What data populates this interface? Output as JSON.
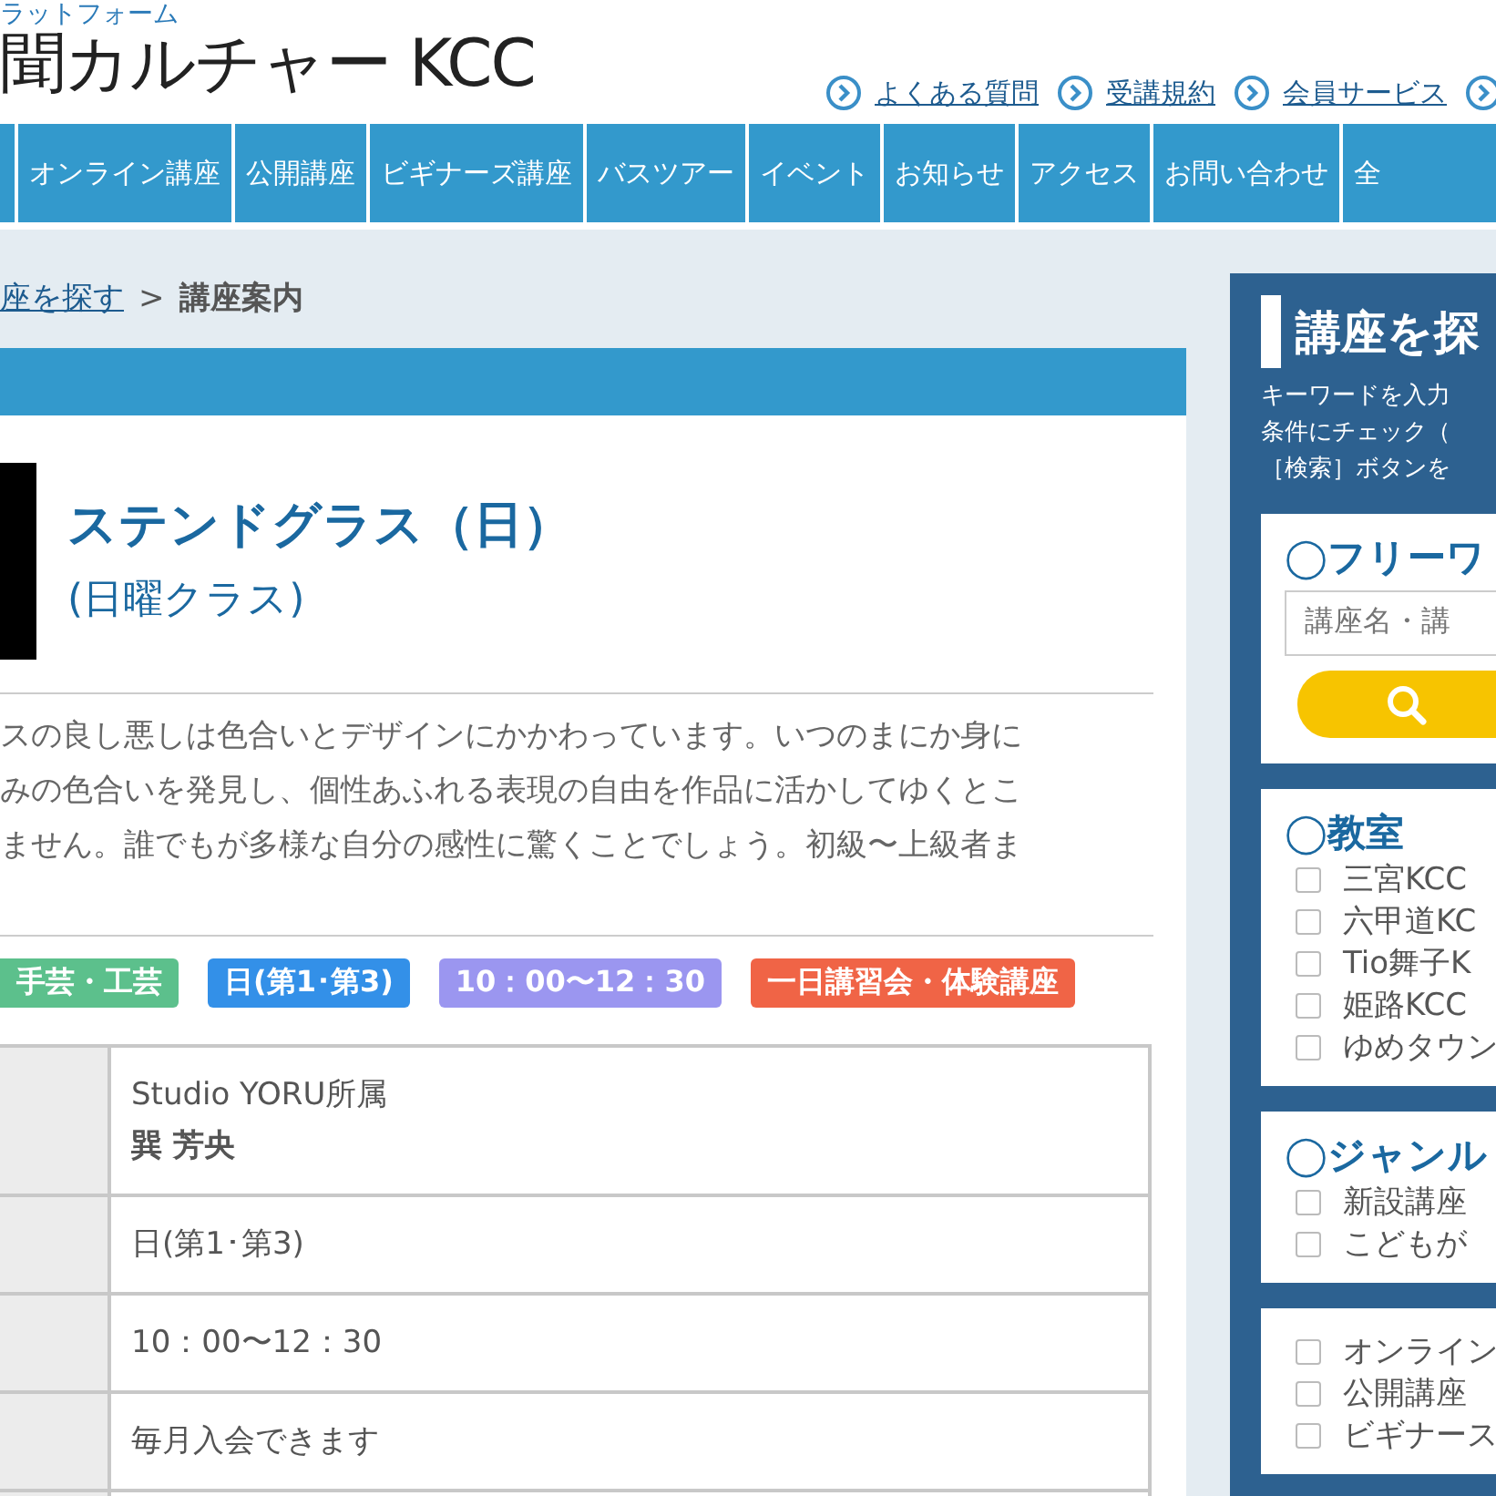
{
  "header": {
    "logo_sub": "ラットフォーム",
    "logo": "聞カルチャー KCC",
    "links": [
      "よくある質問",
      "受講規約",
      "会員サービス"
    ]
  },
  "nav": [
    "オンライン講座",
    "公開講座",
    "ビギナーズ講座",
    "バスツアー",
    "イベント",
    "お知らせ",
    "アクセス",
    "お問い合わせ",
    "全"
  ],
  "breadcrumb": {
    "link": "座を探す",
    "separator": ">",
    "current": "講座案内"
  },
  "course": {
    "title": "ステンドグラス（日）",
    "subtitle": "(日曜クラス)",
    "description": [
      "スの良し悪しは色合いとデザインにかかわっています。いつのまにか身に",
      "みの色合いを発見し、個性あふれる表現の自由を作品に活かしてゆくとこ",
      "ません。誰でもが多様な自分の感性に驚くことでしょう。初級〜上級者ま"
    ],
    "tags": [
      {
        "label": "手芸・工芸",
        "color": "#5cc08c"
      },
      {
        "label": "日(第1･第3)",
        "color": "#3390e8"
      },
      {
        "label": "10：00〜12：30",
        "color": "#9b96f0"
      },
      {
        "label": "一日講習会・体験講座",
        "color": "#f06446"
      }
    ],
    "details": [
      {
        "lines": [
          "Studio YORU所属",
          "巽 芳央"
        ]
      },
      {
        "lines": [
          "日(第1･第3)"
        ]
      },
      {
        "lines": [
          "10：00〜12：30"
        ]
      },
      {
        "lines": [
          "毎月入会できます"
        ]
      }
    ]
  },
  "sidebar": {
    "title": "講座を探",
    "intro": [
      "キーワードを入力",
      "条件にチェック（",
      "［検索］ボタンを"
    ],
    "freeword": {
      "heading": "◯フリーワ",
      "placeholder": "講座名・講"
    },
    "groups": [
      {
        "heading": "◯教室",
        "options": [
          {
            "label": "三宮KCC",
            "checked": false
          },
          {
            "label": "六甲道KC",
            "checked": false
          },
          {
            "label": "Tio舞子K",
            "checked": false
          },
          {
            "label": "姫路KCC",
            "checked": false
          },
          {
            "label": "ゆめタウン",
            "checked": false
          }
        ]
      },
      {
        "heading": "◯ジャンル",
        "options": [
          {
            "label": "新設講座",
            "checked": false
          },
          {
            "label": "こどもが",
            "checked": false
          }
        ]
      },
      {
        "options": [
          {
            "label": "オンライン",
            "checked": false
          },
          {
            "label": "公開講座",
            "checked": false
          },
          {
            "label": "ビギナース",
            "checked": false
          }
        ]
      }
    ]
  }
}
